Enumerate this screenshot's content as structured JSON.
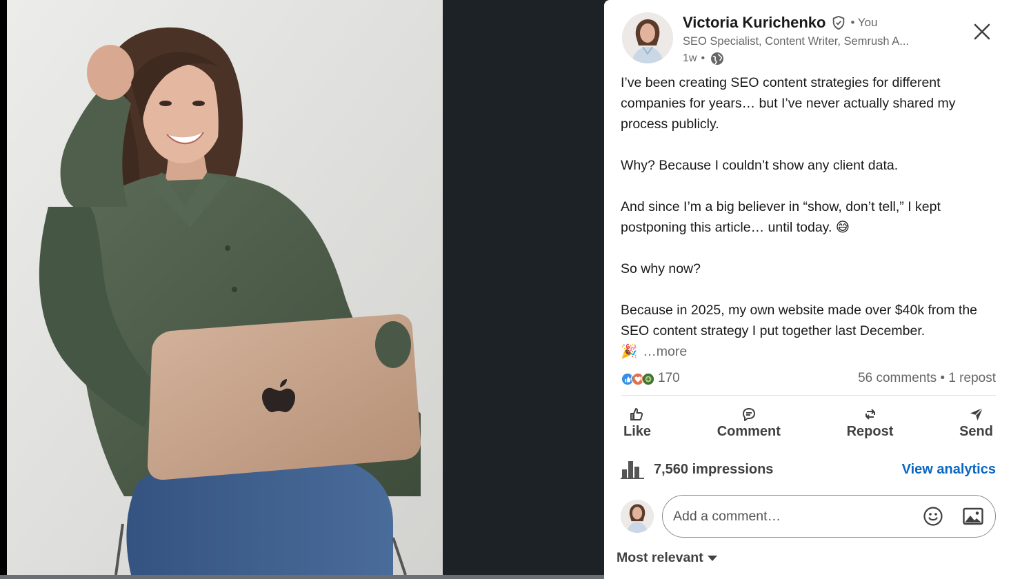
{
  "post": {
    "author_name": "Victoria Kurichenko",
    "you_label": "• You",
    "headline": "SEO Specialist, Content Writer, Semrush A...",
    "time": "1w",
    "time_separator": "•",
    "body": {
      "line1": "I’ve been creating SEO content strategies for different companies for years… but I’ve never actually shared my process publicly.",
      "line2": "Why? Because I couldn’t show any client data.",
      "line3": "And since I’m a big believer in “show, don’t tell,” I kept postponing this article… until today. 😅",
      "line4": "So why now?",
      "line5": "Because in 2025, my own website made over $40k from the SEO content strategy I put together last December.",
      "line5_emoji": "🎉",
      "more_label": "…more"
    },
    "reactions_count": "170",
    "comments_reposts": "56 comments • 1 repost"
  },
  "actions": {
    "like": "Like",
    "comment": "Comment",
    "repost": "Repost",
    "send": "Send"
  },
  "analytics": {
    "impressions": "7,560 impressions",
    "view_label": "View analytics"
  },
  "comment_box": {
    "placeholder": "Add a comment…"
  },
  "sort": {
    "label": "Most relevant"
  },
  "colors": {
    "accent": "#0a66c2",
    "shirt": "#4b5a48",
    "laptop": "#c9a58e",
    "jeans": "#3f5f8c"
  }
}
